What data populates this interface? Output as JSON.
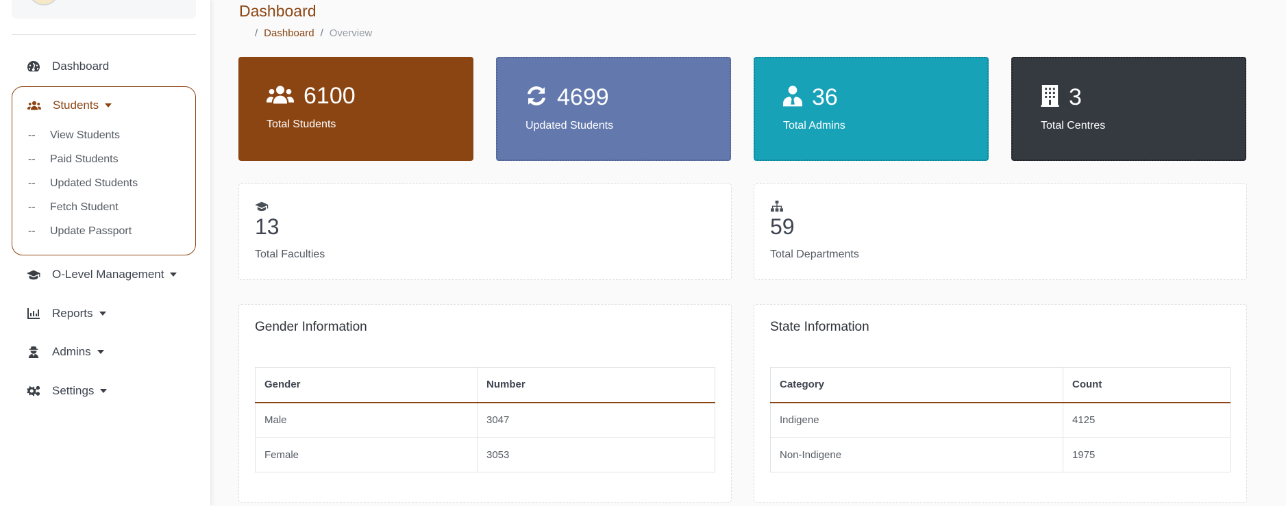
{
  "sidebar": {
    "items": [
      {
        "label": "Dashboard",
        "icon": "tachometer-icon"
      },
      {
        "label": "Students",
        "icon": "users-icon",
        "expanded": true,
        "children": [
          {
            "prefix": "--",
            "label": "View Students"
          },
          {
            "prefix": "--",
            "label": "Paid Students"
          },
          {
            "prefix": "--",
            "label": "Updated Students"
          },
          {
            "prefix": "--",
            "label": "Fetch Student"
          },
          {
            "prefix": "--",
            "label": "Update Passport"
          }
        ]
      },
      {
        "label": "O-Level Management",
        "icon": "graduation-cap-icon"
      },
      {
        "label": "Reports",
        "icon": "chart-bar-icon"
      },
      {
        "label": "Admins",
        "icon": "user-secret-icon"
      },
      {
        "label": "Settings",
        "icon": "cogs-icon"
      }
    ]
  },
  "header": {
    "title": "Dashboard",
    "breadcrumb": {
      "sep": "/",
      "link": "Dashboard",
      "current": "Overview"
    }
  },
  "stats": [
    {
      "value": "6100",
      "label": "Total Students",
      "icon": "users-icon",
      "color": "#8b4513"
    },
    {
      "value": "4699",
      "label": "Updated Students",
      "icon": "sync-icon",
      "color": "#6379ae"
    },
    {
      "value": "36",
      "label": "Total Admins",
      "icon": "user-tie-icon",
      "color": "#17a2b8"
    },
    {
      "value": "3",
      "label": "Total Centres",
      "icon": "building-icon",
      "color": "#343a40"
    }
  ],
  "info": [
    {
      "value": "13",
      "label": "Total Faculties",
      "icon": "graduation-cap-icon"
    },
    {
      "value": "59",
      "label": "Total Departments",
      "icon": "sitemap-icon"
    }
  ],
  "gender": {
    "title": "Gender Information",
    "headers": [
      "Gender",
      "Number"
    ],
    "rows": [
      [
        "Male",
        "3047"
      ],
      [
        "Female",
        "3053"
      ]
    ]
  },
  "state": {
    "title": "State Information",
    "headers": [
      "Category",
      "Count"
    ],
    "rows": [
      [
        "Indigene",
        "4125"
      ],
      [
        "Non-Indigene",
        "1975"
      ]
    ]
  },
  "accent": "#8b4513"
}
